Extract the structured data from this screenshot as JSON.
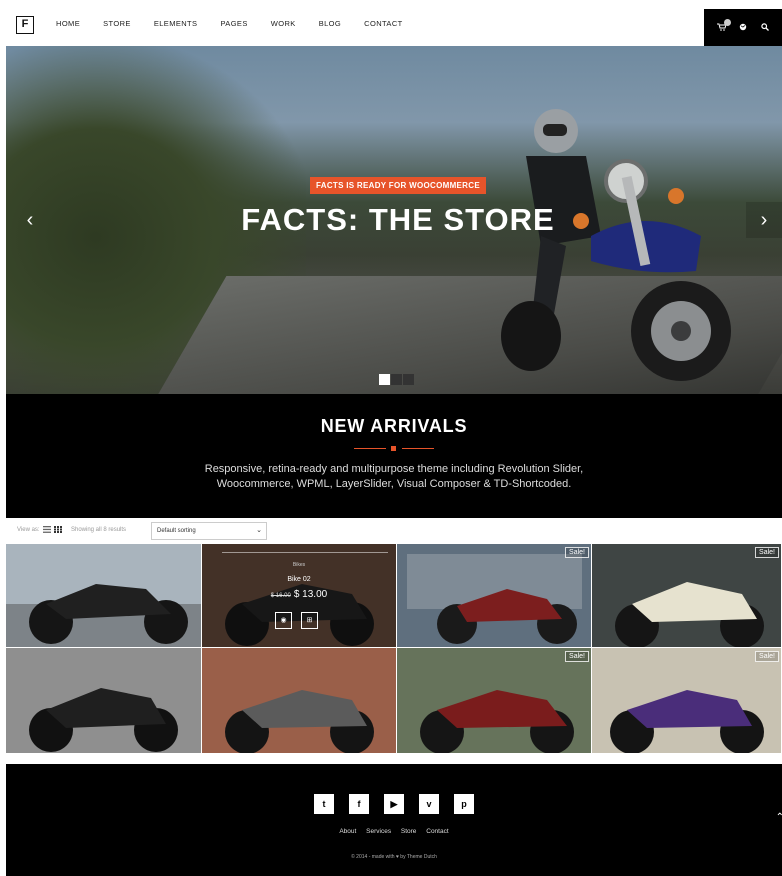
{
  "header": {
    "logo": "F",
    "nav": [
      "HOME",
      "STORE",
      "ELEMENTS",
      "PAGES",
      "WORK",
      "BLOG",
      "CONTACT"
    ],
    "icons": [
      "cart-icon",
      "globe-icon",
      "search-icon"
    ]
  },
  "hero": {
    "tag": "FACTS IS READY FOR WOOCOMMERCE",
    "title": "FACTS: THE STORE",
    "slides": 3,
    "active_slide": 1,
    "accent": "#e7542a"
  },
  "arrivals": {
    "title": "NEW ARRIVALS",
    "description_line1": "Responsive, retina-ready and multipurpose theme including Revolution Slider,",
    "description_line2": "Woocommerce, WPML, LayerSlider, Visual Composer & TD-Shortcoded."
  },
  "toolbar": {
    "view_as": "View as:",
    "results": "Showing all 8 results",
    "sort": "Default sorting"
  },
  "products": [
    {
      "sale": "",
      "color": "#8a96a3"
    },
    {
      "sale": "",
      "color": "#7a5a48",
      "hover": {
        "category": "Bikes",
        "name": "Bike 02",
        "old_price": "$ 16.00",
        "price": "$ 13.00"
      }
    },
    {
      "sale": "Sale!",
      "color": "#6d7a86"
    },
    {
      "sale": "Sale!",
      "color": "#4e5453"
    },
    {
      "sale": "",
      "color": "#8d8d8d"
    },
    {
      "sale": "",
      "color": "#9a5f49"
    },
    {
      "sale": "Sale!",
      "color": "#6f7a63"
    },
    {
      "sale": "Sale!",
      "color": "#c8c2b2"
    }
  ],
  "footer": {
    "social": [
      "twitter-icon",
      "facebook-icon",
      "youtube-icon",
      "vimeo-icon",
      "pinterest-icon"
    ],
    "links": [
      "About",
      "Services",
      "Store",
      "Contact"
    ],
    "copyright_prefix": "© 2014 - made with",
    "copyright_suffix": "by Theme Dutch"
  }
}
